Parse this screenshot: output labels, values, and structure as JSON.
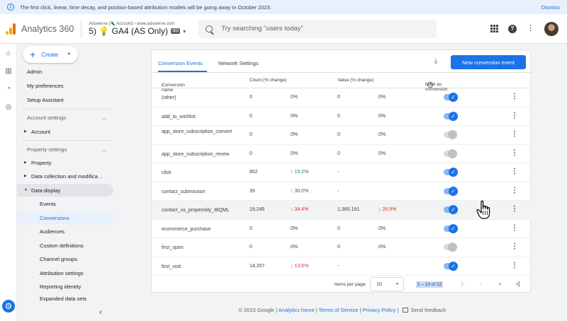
{
  "banner": {
    "icon": "info-icon",
    "text": "The first click, linear, time decay, and position-based attribution models will be going away in October 2023.",
    "dismiss": "Dismiss"
  },
  "header": {
    "app_name": "Analytics 360",
    "account_crumb": "Adswerve (🔦 Account) › www.adswerve.com",
    "property": "5) 💡 GA4 (AS Only)",
    "property_badge": "360",
    "search_placeholder": "Try searching \"users today\""
  },
  "create": {
    "label": "Create"
  },
  "nav": {
    "admin": "Admin",
    "preferences": "My preferences",
    "setup": "Setup Assistant",
    "account_settings": "Account settings",
    "account": "Account",
    "property_settings": "Property settings",
    "property": "Property",
    "data_collection": "Data collection and modifica...",
    "data_display": "Data display",
    "sub": [
      "Events",
      "Conversions",
      "Audiences",
      "Custom definitions",
      "Channel groups",
      "Attribution settings",
      "Reporting identity",
      "Expanded data sets"
    ]
  },
  "tabs": [
    "Conversion Events",
    "Network Settings"
  ],
  "new_button": "New conversion event",
  "columns": {
    "name": "Conversion name",
    "count": "Count (% change)",
    "value": "Value (% change)",
    "mark": "Mark as conversion"
  },
  "rows": [
    {
      "name": "(other)",
      "count": "0",
      "count_pct": "0%",
      "value": "0",
      "value_pct": "0%",
      "on": true
    },
    {
      "name": "add_to_wishlist",
      "count": "0",
      "count_pct": "0%",
      "value": "0",
      "value_pct": "0%",
      "on": true
    },
    {
      "name": "app_store_subscription_convert",
      "count": "0",
      "count_pct": "0%",
      "value": "0",
      "value_pct": "0%",
      "on": false
    },
    {
      "name": "app_store_subscription_renew",
      "count": "0",
      "count_pct": "0%",
      "value": "0",
      "value_pct": "0%",
      "on": false
    },
    {
      "name": "click",
      "count": "862",
      "count_pct": "15.2%",
      "value": "-",
      "value_pct": "",
      "on": true
    },
    {
      "name": "contact_submission",
      "count": "39",
      "count_pct": "30.0%",
      "value": "-",
      "value_pct": "",
      "on": true
    },
    {
      "name": "contact_us_propensity_IBQML",
      "count": "19,245",
      "count_pct": "34.4%",
      "value": "1,360,191",
      "value_pct": "26.9%",
      "on": true
    },
    {
      "name": "ecommerce_purchase",
      "count": "0",
      "count_pct": "0%",
      "value": "0",
      "value_pct": "0%",
      "on": true
    },
    {
      "name": "first_open",
      "count": "0",
      "count_pct": "0%",
      "value": "0",
      "value_pct": "0%",
      "on": false
    },
    {
      "name": "first_visit",
      "count": "14,207",
      "count_pct": "13.6%",
      "value": "-",
      "value_pct": "",
      "on": true
    }
  ],
  "pager": {
    "items_label": "Items per page:",
    "items_value": "10",
    "range": "1 – 10 of 22"
  },
  "footer": {
    "copyright": "© 2023 Google |",
    "analytics_home": "Analytics home",
    "terms": "Terms of Service",
    "privacy": "Privacy Policy",
    "feedback": "Send feedback"
  },
  "colors": {
    "accent": "#1a73e8",
    "up": "#188038",
    "down": "#d93025"
  }
}
